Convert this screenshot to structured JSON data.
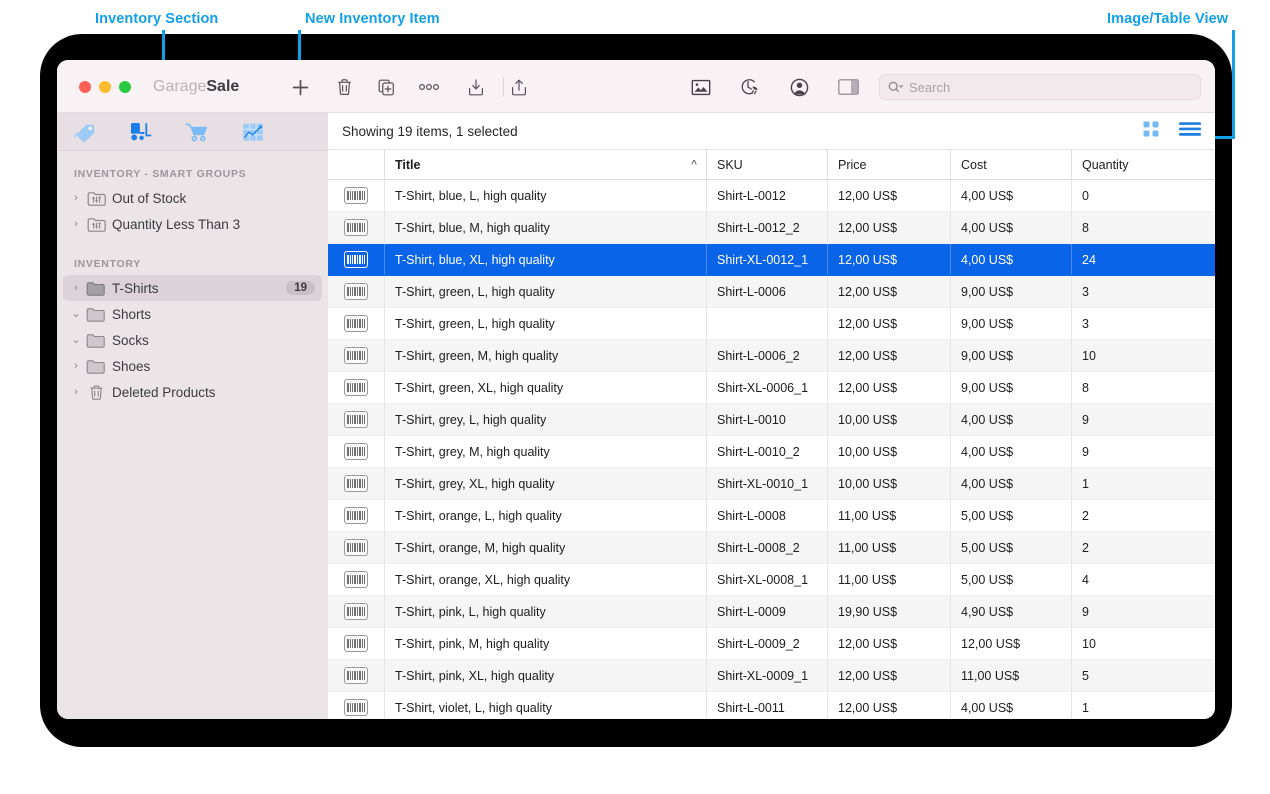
{
  "annotations": [
    {
      "id": "inventory-section",
      "label": "Inventory Section"
    },
    {
      "id": "new-inventory-item",
      "label": "New Inventory Item"
    },
    {
      "id": "image-table-view",
      "label": "Image/Table View"
    }
  ],
  "window": {
    "title_light": "Garage",
    "title_bold": "Sale",
    "traffic_lights": [
      "close",
      "minimize",
      "zoom"
    ],
    "toolbar": {
      "add_label": "+",
      "buttons": [
        {
          "name": "add-button",
          "icon": "plus-icon"
        },
        {
          "name": "delete-button",
          "icon": "trash-icon"
        },
        {
          "name": "duplicate-button",
          "icon": "duplicate-icon"
        },
        {
          "name": "more-button",
          "icon": "ellipsis-icon"
        },
        {
          "name": "import-button",
          "icon": "download-icon"
        },
        {
          "name": "share-button",
          "icon": "share-icon"
        },
        {
          "name": "images-button",
          "icon": "picture-icon"
        },
        {
          "name": "scheduled-button",
          "icon": "clock-rocket-icon"
        },
        {
          "name": "account-button",
          "icon": "person-icon"
        },
        {
          "name": "inspector-button",
          "icon": "sidebar-toggle-icon"
        }
      ]
    },
    "search": {
      "placeholder": "Search",
      "value": ""
    }
  },
  "sidebar": {
    "tabs": [
      {
        "name": "tab-tags",
        "icon": "tag-icon",
        "selected": false
      },
      {
        "name": "tab-inventory",
        "icon": "forklift-icon",
        "selected": true
      },
      {
        "name": "tab-orders",
        "icon": "cart-icon",
        "selected": false
      },
      {
        "name": "tab-statistics",
        "icon": "chart-icon",
        "selected": false
      }
    ],
    "smart_groups_header": "Inventory - Smart Groups",
    "smart_groups": [
      {
        "label": "Out of Stock",
        "icon": "smart-folder-icon",
        "expanded": false
      },
      {
        "label": "Quantity Less Than 3",
        "icon": "smart-folder-icon",
        "expanded": false
      }
    ],
    "inventory_header": "Inventory",
    "inventory": [
      {
        "label": "T-Shirts",
        "icon": "folder-icon",
        "expanded": false,
        "badge": "19",
        "selected": true
      },
      {
        "label": "Shorts",
        "icon": "folder-icon",
        "expanded": true,
        "badge": "",
        "selected": false
      },
      {
        "label": "Socks",
        "icon": "folder-icon",
        "expanded": true,
        "badge": "",
        "selected": false
      },
      {
        "label": "Shoes",
        "icon": "folder-icon",
        "expanded": false,
        "badge": "",
        "selected": false
      },
      {
        "label": "Deleted Products",
        "icon": "trash-icon",
        "expanded": false,
        "badge": "",
        "selected": false
      }
    ]
  },
  "main": {
    "status": "Showing 19 items, 1 selected",
    "view_toggle": {
      "grid": "grid-view-icon",
      "list": "list-view-icon",
      "active": "list"
    },
    "columns": [
      "",
      "Title",
      "SKU",
      "Price",
      "Cost",
      "Quantity"
    ],
    "sort_column": "Title",
    "sort_direction": "asc",
    "rows": [
      {
        "icon": "barcode-icon",
        "title": "T-Shirt, blue, L, high quality",
        "sku": "Shirt-L-0012",
        "price": "12,00 US$",
        "cost": "4,00 US$",
        "quantity": "0",
        "selected": false
      },
      {
        "icon": "barcode-icon",
        "title": "T-Shirt, blue, M, high quality",
        "sku": "Shirt-L-0012_2",
        "price": "12,00 US$",
        "cost": "4,00 US$",
        "quantity": "8",
        "selected": false
      },
      {
        "icon": "barcode-icon",
        "title": "T-Shirt, blue, XL, high quality",
        "sku": "Shirt-XL-0012_1",
        "price": "12,00 US$",
        "cost": "4,00 US$",
        "quantity": "24",
        "selected": true
      },
      {
        "icon": "barcode-icon",
        "title": "T-Shirt, green, L, high quality",
        "sku": "Shirt-L-0006",
        "price": "12,00 US$",
        "cost": "9,00 US$",
        "quantity": "3",
        "selected": false
      },
      {
        "icon": "barcode-icon",
        "title": "T-Shirt, green, L, high quality",
        "sku": "",
        "price": "12,00 US$",
        "cost": "9,00 US$",
        "quantity": "3",
        "selected": false
      },
      {
        "icon": "barcode-icon",
        "title": "T-Shirt, green, M, high quality",
        "sku": "Shirt-L-0006_2",
        "price": "12,00 US$",
        "cost": "9,00 US$",
        "quantity": "10",
        "selected": false
      },
      {
        "icon": "barcode-icon",
        "title": "T-Shirt, green, XL, high quality",
        "sku": "Shirt-XL-0006_1",
        "price": "12,00 US$",
        "cost": "9,00 US$",
        "quantity": "8",
        "selected": false
      },
      {
        "icon": "barcode-icon",
        "title": "T-Shirt, grey, L, high quality",
        "sku": "Shirt-L-0010",
        "price": "10,00 US$",
        "cost": "4,00 US$",
        "quantity": "9",
        "selected": false
      },
      {
        "icon": "barcode-icon",
        "title": "T-Shirt, grey, M, high quality",
        "sku": "Shirt-L-0010_2",
        "price": "10,00 US$",
        "cost": "4,00 US$",
        "quantity": "9",
        "selected": false
      },
      {
        "icon": "barcode-icon",
        "title": "T-Shirt, grey, XL, high quality",
        "sku": "Shirt-XL-0010_1",
        "price": "10,00 US$",
        "cost": "4,00 US$",
        "quantity": "1",
        "selected": false
      },
      {
        "icon": "barcode-icon",
        "title": "T-Shirt, orange, L, high quality",
        "sku": "Shirt-L-0008",
        "price": "11,00 US$",
        "cost": "5,00 US$",
        "quantity": "2",
        "selected": false
      },
      {
        "icon": "barcode-icon",
        "title": "T-Shirt, orange, M, high quality",
        "sku": "Shirt-L-0008_2",
        "price": "11,00 US$",
        "cost": "5,00 US$",
        "quantity": "2",
        "selected": false
      },
      {
        "icon": "barcode-icon",
        "title": "T-Shirt, orange, XL, high quality",
        "sku": "Shirt-XL-0008_1",
        "price": "11,00 US$",
        "cost": "5,00 US$",
        "quantity": "4",
        "selected": false
      },
      {
        "icon": "barcode-icon",
        "title": "T-Shirt, pink, L, high quality",
        "sku": "Shirt-L-0009",
        "price": "19,90 US$",
        "cost": "4,90 US$",
        "quantity": "9",
        "selected": false
      },
      {
        "icon": "barcode-icon",
        "title": "T-Shirt, pink, M, high quality",
        "sku": "Shirt-L-0009_2",
        "price": "12,00 US$",
        "cost": "12,00 US$",
        "quantity": "10",
        "selected": false
      },
      {
        "icon": "barcode-icon",
        "title": "T-Shirt, pink, XL, high quality",
        "sku": "Shirt-XL-0009_1",
        "price": "12,00 US$",
        "cost": "11,00 US$",
        "quantity": "5",
        "selected": false
      },
      {
        "icon": "barcode-icon",
        "title": "T-Shirt, violet, L, high quality",
        "sku": "Shirt-L-0011",
        "price": "12,00 US$",
        "cost": "4,00 US$",
        "quantity": "1",
        "selected": false
      }
    ]
  },
  "colors": {
    "accent_blue": "#12a0e8",
    "selection_blue": "#0a64e8",
    "tab_blue": "#1a7fe8",
    "tab_blue_light": "#8dc4f5"
  }
}
